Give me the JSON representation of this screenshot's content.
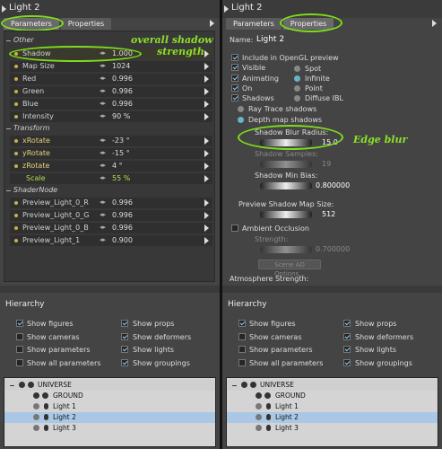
{
  "left": {
    "title": "Light 2",
    "tabs": [
      "Parameters",
      "Properties"
    ],
    "groups": {
      "other": "Other",
      "transform": "Transform",
      "shadernode": "ShaderNode"
    },
    "params": [
      {
        "label": "Shadow",
        "value": "1.000"
      },
      {
        "label": "Map Size",
        "value": "1024"
      },
      {
        "label": "Red",
        "value": "0.996"
      },
      {
        "label": "Green",
        "value": "0.996"
      },
      {
        "label": "Blue",
        "value": "0.996"
      },
      {
        "label": "Intensity",
        "value": "90 %"
      },
      {
        "label": "xRotate",
        "value": "-23 °"
      },
      {
        "label": "yRotate",
        "value": "-15 °"
      },
      {
        "label": "zRotate",
        "value": "4 °"
      },
      {
        "label": "Scale",
        "value": "55 %"
      },
      {
        "label": "Preview_Light_0_R",
        "value": "0.996"
      },
      {
        "label": "Preview_Light_0_G",
        "value": "0.996"
      },
      {
        "label": "Preview_Light_0_B",
        "value": "0.996"
      },
      {
        "label": "Preview_Light_1",
        "value": "0.900"
      }
    ],
    "annotation": [
      "overall shadow",
      "strength"
    ]
  },
  "right": {
    "title": "Light 2",
    "tabs": [
      "Parameters",
      "Properties"
    ],
    "name_label": "Name:",
    "name_value": "Light 2",
    "checks": [
      {
        "label": "Include in OpenGL preview",
        "on": true
      },
      {
        "label": "Visible",
        "on": true
      },
      {
        "label": "Animating",
        "on": true
      },
      {
        "label": "On",
        "on": true
      },
      {
        "label": "Shadows",
        "on": true
      }
    ],
    "light_types": [
      {
        "label": "Spot",
        "sel": false
      },
      {
        "label": "Infinite",
        "sel": true
      },
      {
        "label": "Point",
        "sel": false
      },
      {
        "label": "Diffuse IBL",
        "sel": false
      }
    ],
    "shadow_types": [
      {
        "label": "Ray Trace shadows",
        "sel": false
      },
      {
        "label": "Depth map shadows",
        "sel": true
      }
    ],
    "blur_label": "Shadow Blur Radius:",
    "blur_value": "15.0",
    "samples_label": "Shadow Samples:",
    "samples_value": "19",
    "minbias_label": "Shadow Min Bias:",
    "minbias_value": "0.800000",
    "mapsize_label": "Preview Shadow Map Size:",
    "mapsize_value": "512",
    "ao_label": "Ambient Occlusion",
    "strength_label": "Strength:",
    "strength_value": "0.700000",
    "ao_button": "Scene AO Options...",
    "atmos_label": "Atmosphere Strength:",
    "annotation": "Edge blur"
  },
  "hierarchy": {
    "title": "Hierarchy",
    "options": [
      {
        "label": "Show figures",
        "on": true
      },
      {
        "label": "Show props",
        "on": true
      },
      {
        "label": "Show cameras",
        "on": false
      },
      {
        "label": "Show deformers",
        "on": true
      },
      {
        "label": "Show parameters",
        "on": false
      },
      {
        "label": "Show lights",
        "on": true
      },
      {
        "label": "Show all parameters",
        "on": false
      },
      {
        "label": "Show groupings",
        "on": true
      }
    ],
    "tree": [
      "UNIVERSE",
      "GROUND",
      "Light 1",
      "Light 2",
      "Light 3"
    ]
  },
  "colors": {
    "accent": "#7edc1c",
    "selection": "#aac8e6",
    "panel": "#444444"
  }
}
